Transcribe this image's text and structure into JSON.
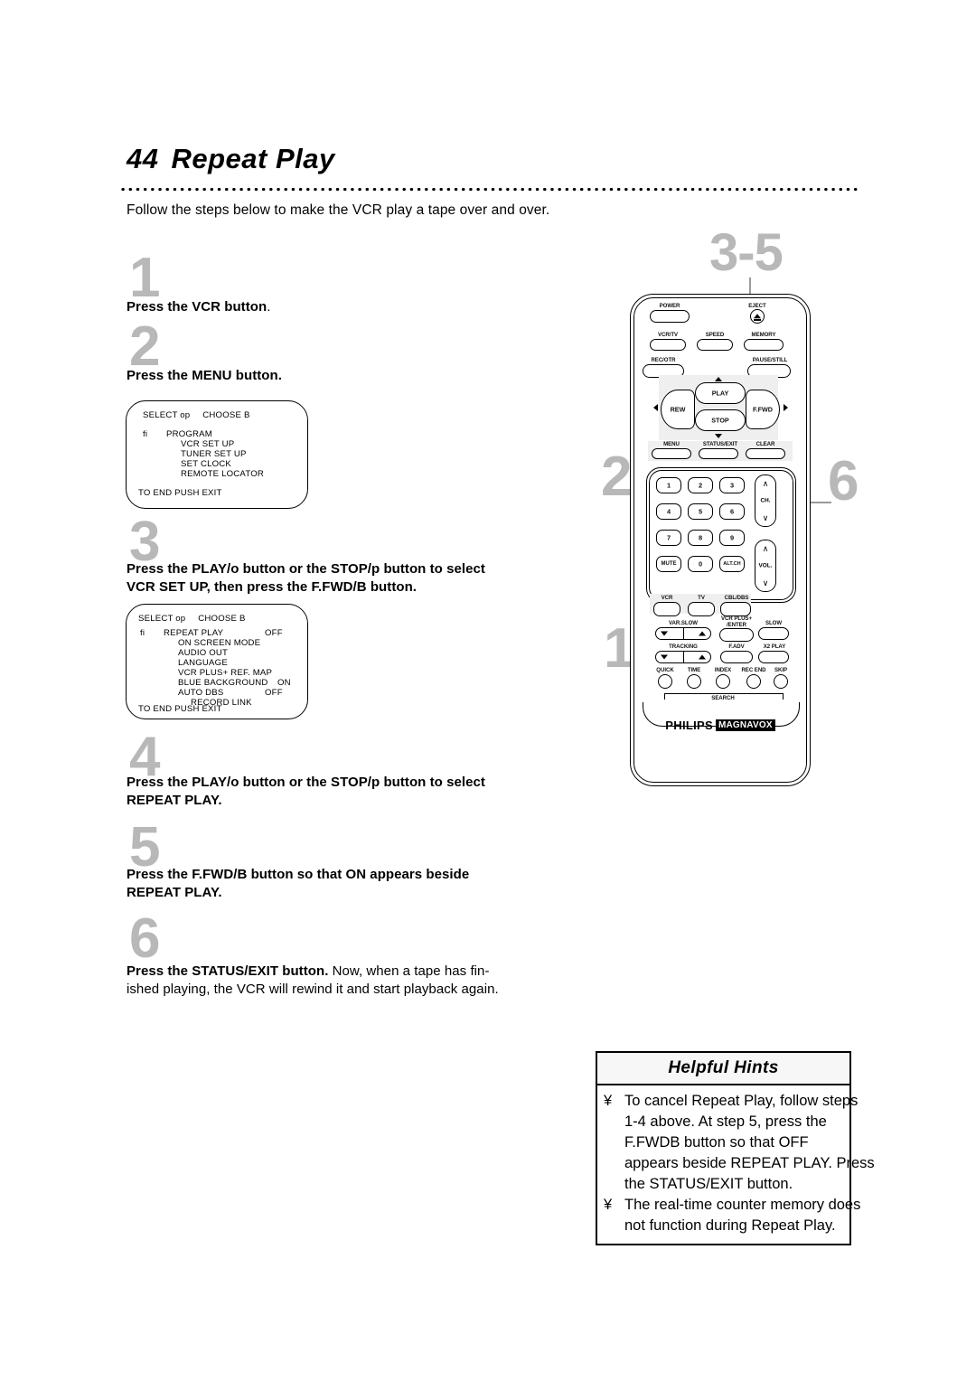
{
  "page": {
    "number": "44",
    "title": "Repeat Play",
    "intro": "Follow the steps below to make the VCR play a tape over and over."
  },
  "steps": [
    {
      "num": "1",
      "text_bold": "Press the VCR button",
      "text_tail": "."
    },
    {
      "num": "2",
      "text_bold": "Press the MENU button.",
      "text_tail": ""
    },
    {
      "num": "3",
      "line1": "Press the PLAY/o  button or the STOP/p  button to select",
      "line2": "VCR SET UP, then press the F.FWD/B  button."
    },
    {
      "num": "4",
      "line1": "Press the PLAY/o  button or the STOP/p  button to select",
      "line2": "REPEAT PLAY."
    },
    {
      "num": "5",
      "line1": "Press the F.FWD/B  button so that ON appears beside",
      "line2": "REPEAT PLAY."
    },
    {
      "num": "6",
      "bold": "Press the STATUS/EXIT button.",
      "rest1": " Now, when a tape has fin-",
      "rest2": "ished playing, the VCR will rewind it and start playback again."
    }
  ],
  "osd_menu_1": {
    "header_left": "SELECT op",
    "header_right": "CHOOSE B",
    "marker": "fi",
    "rows": [
      {
        "marker": "fi",
        "label": "PROGRAM",
        "value": "",
        "indent": false
      },
      {
        "marker": "",
        "label": "VCR SET UP",
        "value": "",
        "indent": false
      },
      {
        "marker": "",
        "label": "TUNER SET UP",
        "value": "",
        "indent": false
      },
      {
        "marker": "",
        "label": "SET CLOCK",
        "value": "",
        "indent": false
      },
      {
        "marker": "",
        "label": "REMOTE LOCATOR",
        "value": "",
        "indent": false
      }
    ],
    "footer": "TO END PUSH EXIT"
  },
  "osd_menu_2": {
    "header_left": "SELECT op",
    "header_right": "CHOOSE B",
    "rows": [
      {
        "marker": "fi",
        "label": "REPEAT PLAY",
        "value": "OFF",
        "indent": false
      },
      {
        "marker": "",
        "label": "ON SCREEN MODE",
        "value": "",
        "indent": false
      },
      {
        "marker": "",
        "label": "AUDIO OUT",
        "value": "",
        "indent": false
      },
      {
        "marker": "",
        "label": "LANGUAGE",
        "value": "",
        "indent": false
      },
      {
        "marker": "",
        "label": "VCR PLUS+ REF. MAP",
        "value": "",
        "indent": false
      },
      {
        "marker": "",
        "label": "BLUE BACKGROUND",
        "value": "ON",
        "indent": false
      },
      {
        "marker": "",
        "label": "AUTO DBS",
        "value": "OFF",
        "indent": false
      },
      {
        "marker": "",
        "label": "RECORD LINK",
        "value": "",
        "indent": true
      }
    ],
    "footer": "TO END PUSH EXIT"
  },
  "hints": {
    "title": "Helpful Hints",
    "bullet": "¥",
    "items": [
      [
        "To cancel Repeat Play, follow steps",
        "1-4 above. At step 5, press the",
        "F.FWDB  button so that OFF",
        "appears beside REPEAT PLAY. Press",
        "the STATUS/EXIT button."
      ],
      [
        "The real-time counter memory does",
        "not function during Repeat Play."
      ]
    ]
  },
  "callouts": {
    "c35": "3-5",
    "c2": "2",
    "c6": "6",
    "c1": "1"
  },
  "remote": {
    "brand": "PHILIPS",
    "brand_sub": "MAGNAVOX",
    "buttons": {
      "power": "POWER",
      "eject": "EJECT",
      "vcrtv": "VCR/TV",
      "speed": "SPEED",
      "memory": "MEMORY",
      "recotr": "REC/OTR",
      "pausestill": "PAUSE/STILL",
      "play": "PLAY",
      "rew": "REW",
      "ffwd": "F.FWD",
      "stop": "STOP",
      "menu": "MENU",
      "statusexit": "STATUS/EXIT",
      "clear": "CLEAR",
      "mute": "MUTE",
      "altch": "ALT.CH",
      "vcr": "VCR",
      "tv": "TV",
      "cbldbs": "CBL/DBS",
      "ch": "CH.",
      "vol": "VOL.",
      "varslow": "VAR.SLOW",
      "vcrplus": "VCR PLUS+",
      "enter": "/ENTER",
      "slow": "SLOW",
      "tracking": "TRACKING",
      "fadv": "F.ADV",
      "x2play": "X2 PLAY",
      "quick": "QUICK",
      "time": "TIME",
      "index": "INDEX",
      "recend": "REC END",
      "skip": "SKIP",
      "search": "SEARCH"
    },
    "keypad": [
      "1",
      "2",
      "3",
      "4",
      "5",
      "6",
      "7",
      "8",
      "9",
      "0"
    ]
  }
}
